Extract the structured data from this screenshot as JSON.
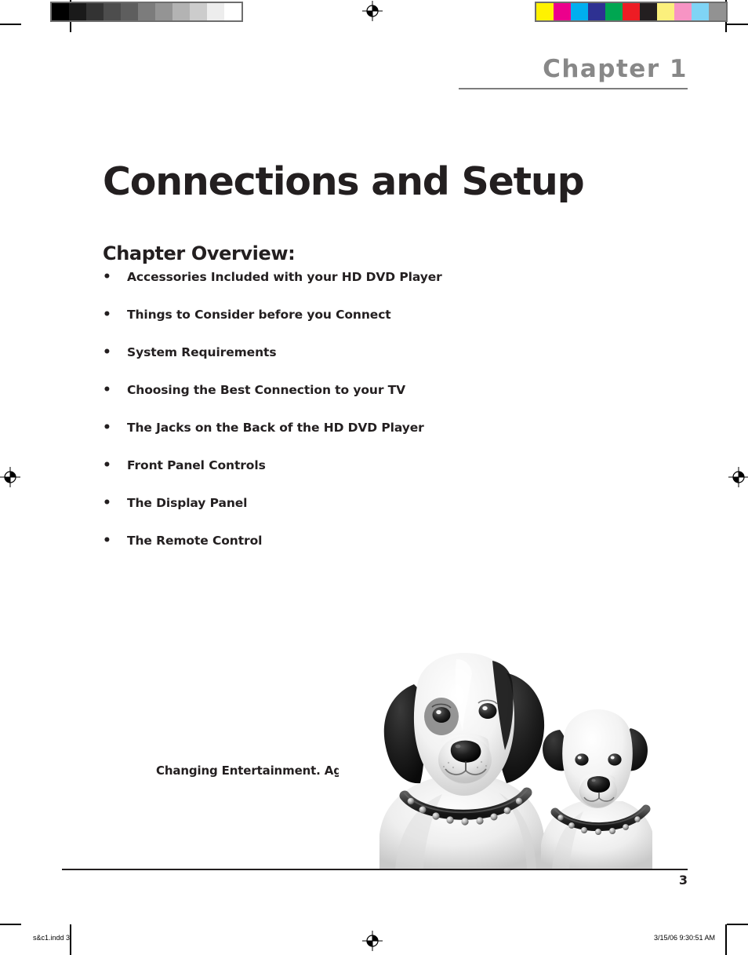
{
  "header": {
    "chapter_label": "Chapter 1"
  },
  "title": "Connections and Setup",
  "overview": {
    "heading": "Chapter Overview:",
    "bullet_glyph": "•",
    "items": [
      "Accessories Included with your HD DVD Player",
      "Things to Consider before you Connect",
      "System Requirements",
      "Choosing the Best Connection to your TV",
      "The Jacks on the Back of the HD DVD Player",
      "Front Panel Controls",
      "The Display Panel",
      "The Remote Control"
    ]
  },
  "tagline": "Changing Entertainment. Again.",
  "photo": {
    "alt": "two-dogs-photo"
  },
  "footer": {
    "page_number": "3",
    "filename": "s&c1.indd   3",
    "timestamp": "3/15/06   9:30:51 AM"
  },
  "print_marks": {
    "gray_bar": [
      "#000000",
      "#1a1a1a",
      "#333333",
      "#4d4d4d",
      "#5e5e5e",
      "#7c7c7c",
      "#949494",
      "#b3b3b3",
      "#cccccc",
      "#ededed",
      "#ffffff"
    ],
    "color_bar": [
      "#fff200",
      "#ec008c",
      "#00aeef",
      "#2e3192",
      "#00a651",
      "#ed1c24",
      "#231f20",
      "#fbf07c",
      "#f794c4",
      "#7fd4f5",
      "#929292"
    ],
    "bar_frame_color": "#6e6e6e"
  }
}
